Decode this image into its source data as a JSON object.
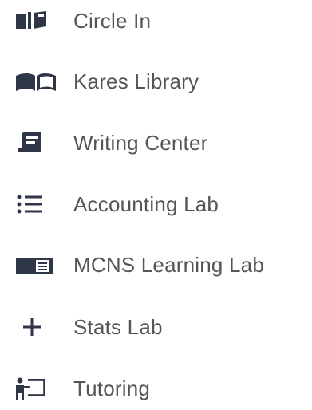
{
  "theme": {
    "icon_color": "#2f3648",
    "label_color": "#555555"
  },
  "menu": {
    "items": [
      {
        "label": "Circle In",
        "icon": "book-icon"
      },
      {
        "label": "Kares Library",
        "icon": "open-book-icon"
      },
      {
        "label": "Writing Center",
        "icon": "scroll-icon"
      },
      {
        "label": "Accounting Lab",
        "icon": "list-icon"
      },
      {
        "label": "MCNS Learning Lab",
        "icon": "notebook-icon"
      },
      {
        "label": "Stats Lab",
        "icon": "plus-icon"
      },
      {
        "label": "Tutoring",
        "icon": "tutor-icon"
      }
    ]
  }
}
